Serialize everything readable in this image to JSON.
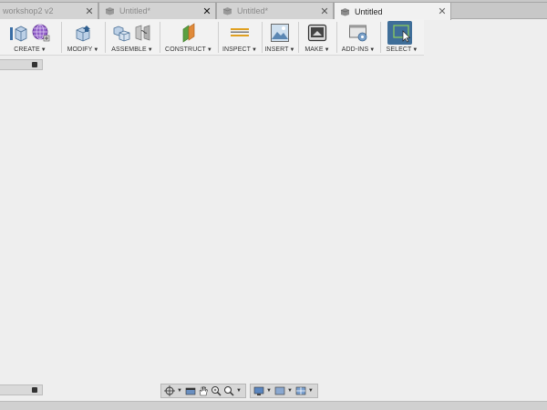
{
  "tabs": [
    {
      "label": "workshop2 v2",
      "active": false,
      "has_icon": false
    },
    {
      "label": "Untitled*",
      "active": false,
      "has_icon": true
    },
    {
      "label": "Untitled*",
      "active": false,
      "has_icon": true
    },
    {
      "label": "Untitled",
      "active": true,
      "has_icon": true
    }
  ],
  "tab_close_glyph": "✕",
  "toolbar": {
    "create": "CREATE",
    "modify": "MODIFY",
    "assemble": "ASSEMBLE",
    "construct": "CONSTRUCT",
    "inspect": "INSPECT",
    "insert": "INSERT",
    "make": "MAKE",
    "addins": "ADD-INS",
    "select": "SELECT",
    "dropdown_glyph": "▼"
  },
  "icons": {
    "create": [
      "sketch-box-icon",
      "sphere-grid-icon"
    ],
    "modify": [
      "press-pull-icon"
    ],
    "assemble": [
      "new-component-icon",
      "joint-icon"
    ],
    "construct": [
      "offset-plane-icon"
    ],
    "inspect": [
      "measure-icon"
    ],
    "insert": [
      "insert-image-icon"
    ],
    "make": [
      "3d-print-icon"
    ],
    "addins": [
      "scripts-addins-icon"
    ],
    "select": [
      "select-cursor-icon"
    ]
  },
  "colors": {
    "accent_select": "#3f6e99",
    "toolbar_bg": "#f2f2f2",
    "canvas_bg": "#eeeeee"
  }
}
